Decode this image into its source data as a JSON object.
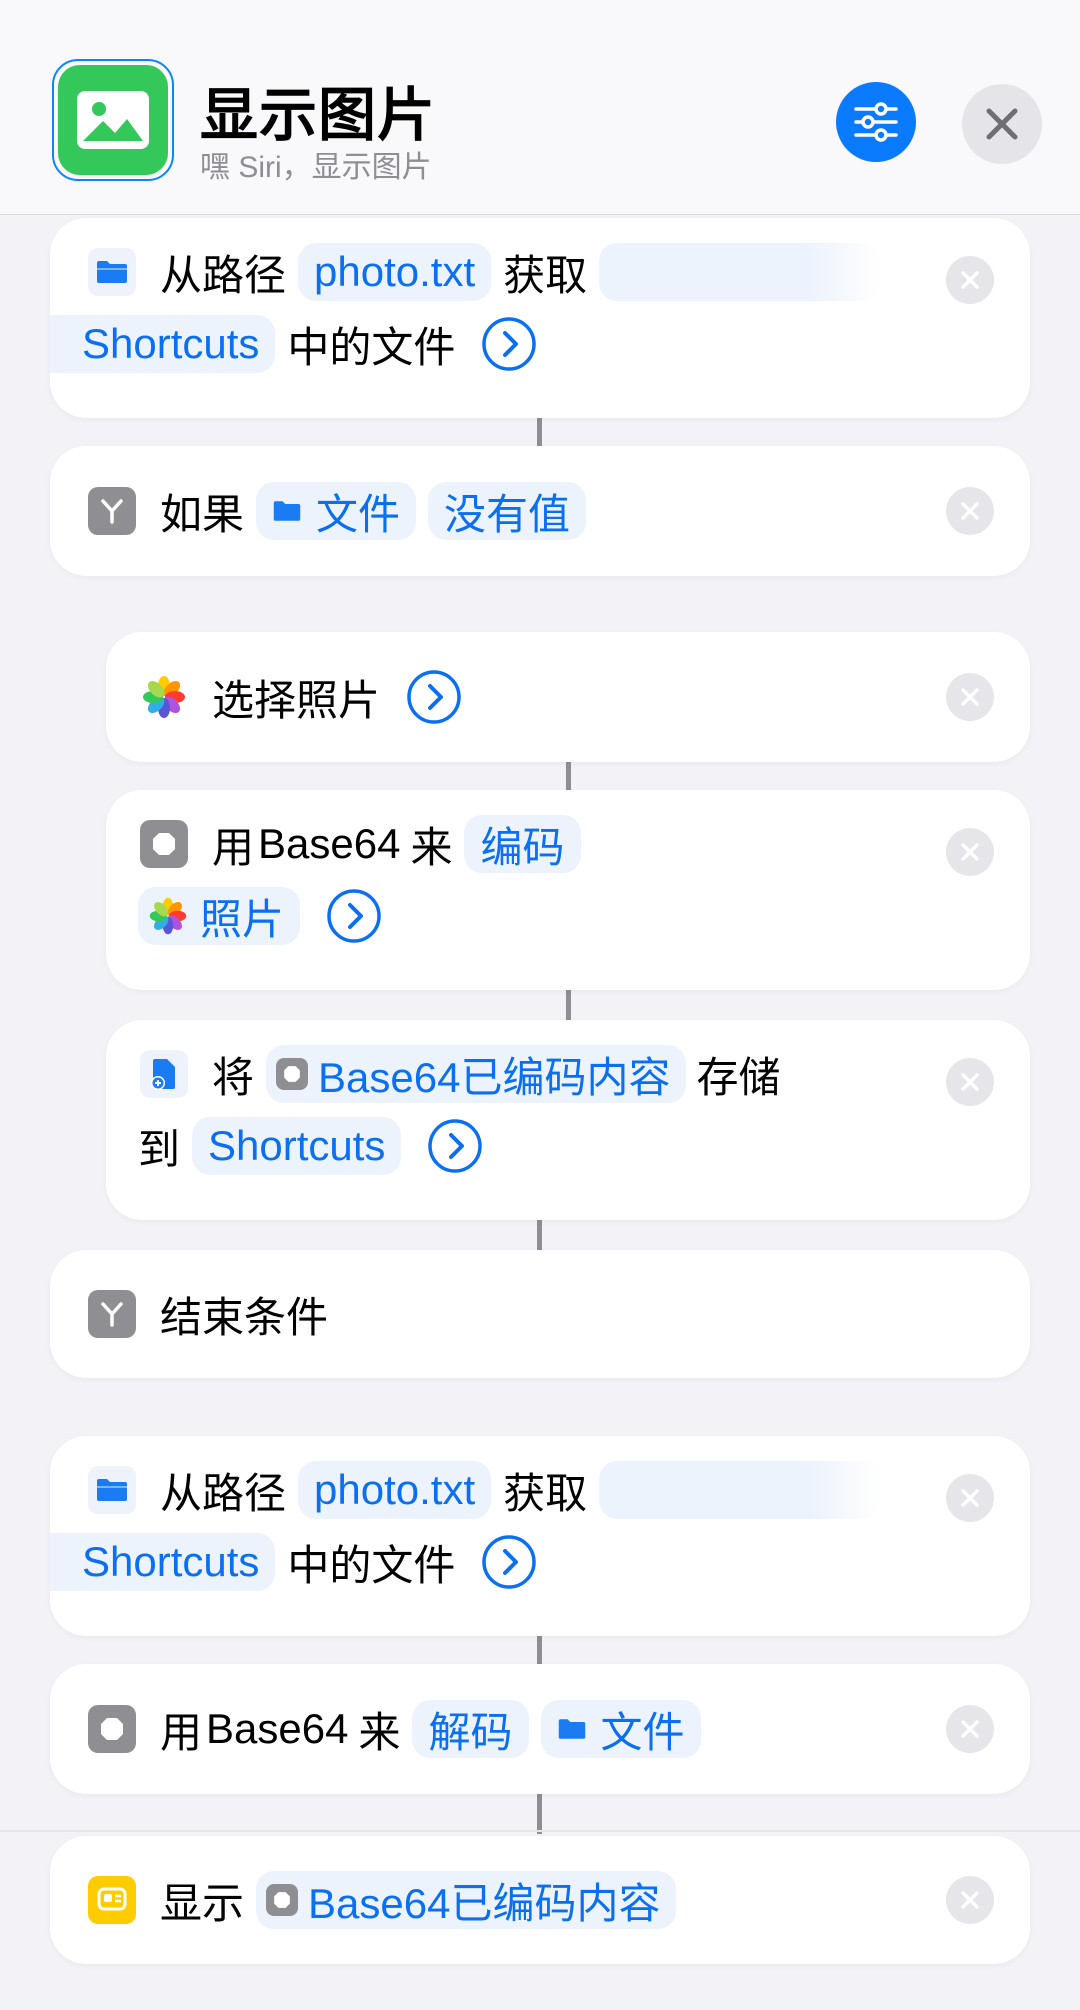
{
  "header": {
    "title": "显示图片",
    "subtitle": "嘿 Siri，显示图片"
  },
  "icons": {
    "app": "photo-icon",
    "settings": "sliders-icon",
    "close": "close-icon"
  },
  "colors": {
    "accent": "#0a7aff",
    "app_icon_bg": "#34c759",
    "token_bg": "#edf3fc",
    "token_text": "#0a6ff0"
  },
  "actions": {
    "get_file_1": {
      "prefix": "从路径",
      "path": "photo.txt",
      "verb": "获取",
      "folder": "Shortcuts",
      "suffix": "中的文件"
    },
    "if": {
      "label": "如果",
      "variable": "文件",
      "condition": "没有值"
    },
    "select_photos": {
      "label": "选择照片"
    },
    "encode": {
      "prefix": "用",
      "method": "Base64",
      "mid": "来",
      "mode": "编码",
      "input": "照片"
    },
    "save": {
      "prefix": "将",
      "content": "Base64已编码内容",
      "verb": "存储",
      "to": "到",
      "destination": "Shortcuts"
    },
    "end_if": {
      "label": "结束条件"
    },
    "get_file_2": {
      "prefix": "从路径",
      "path": "photo.txt",
      "verb": "获取",
      "folder": "Shortcuts",
      "suffix": "中的文件"
    },
    "decode": {
      "prefix": "用",
      "method": "Base64",
      "mid": "来",
      "mode": "解码",
      "input": "文件"
    },
    "show": {
      "label": "显示",
      "content": "Base64已编码内容"
    }
  }
}
